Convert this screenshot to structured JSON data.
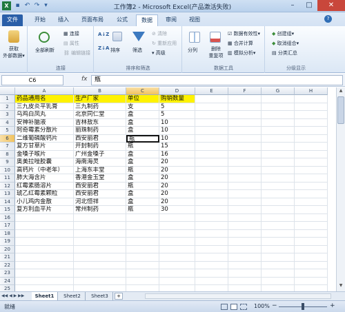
{
  "window": {
    "title": "工作簿2 - Microsoft Excel(产品激活失败)",
    "min": "–",
    "max": "□",
    "close": "✕"
  },
  "qat": {
    "save": "▪",
    "undo": "↶",
    "redo": "↷",
    "more": "▾"
  },
  "tabs": {
    "file": "文件",
    "items": [
      "开始",
      "插入",
      "页面布局",
      "公式",
      "数据",
      "审阅",
      "视图"
    ],
    "active": "数据"
  },
  "ribbon": {
    "get_external": {
      "label1": "获取",
      "label2": "外部数据▾"
    },
    "connections": {
      "refresh_all": "全部刷新",
      "connections": "连接",
      "properties": "属性",
      "edit_links": "编辑链接",
      "group_label": "连接"
    },
    "sort_filter": {
      "sort_az": "A↓Z",
      "sort_za": "Z↓A",
      "sort": "排序",
      "filter": "筛选",
      "clear": "清除",
      "reapply": "重新应用",
      "advanced": "高级",
      "group_label": "排序和筛选"
    },
    "data_tools": {
      "text_to_columns": "分列",
      "remove_dup": "删除",
      "remove_dup2": "重复项",
      "validation": "数据有效性▾",
      "consolidate": "合并计算",
      "whatif": "模拟分析▾",
      "group_label": "数据工具"
    },
    "outline": {
      "group": "创建组▾",
      "ungroup": "取消组合▾",
      "subtotal": "分类汇总",
      "group_label": "分级显示"
    }
  },
  "formula_bar": {
    "name_box": "C6",
    "fx": "fx",
    "content": "瓶"
  },
  "columns": [
    "A",
    "B",
    "C",
    "D",
    "E",
    "F",
    "G",
    "H"
  ],
  "selected_col": "C",
  "rows": [
    "1",
    "2",
    "3",
    "4",
    "5",
    "6",
    "7",
    "8",
    "9",
    "10",
    "11",
    "12",
    "13",
    "14",
    "15",
    "16",
    "17",
    "18",
    "19",
    "20",
    "21",
    "22",
    "23",
    "24",
    "25"
  ],
  "selected_row": "6",
  "table": {
    "header": [
      "药品通用名",
      "生产厂家",
      "单位",
      "购销数量"
    ],
    "body": [
      [
        "三九皮炎平乳膏",
        "三九制药",
        "支",
        "5"
      ],
      [
        "乌鸡白凤丸",
        "北京同仁堂",
        "盒",
        "5"
      ],
      [
        "安神补脑液",
        "吉林敖东",
        "盒",
        "10"
      ],
      [
        "阿奇霉素分散片",
        "丽珠制药",
        "盒",
        "10"
      ],
      [
        "二维葡磷酸钙片",
        "西安丽君",
        "瓶",
        "10"
      ],
      [
        "复方甘草片",
        "开封制药",
        "瓶",
        "15"
      ],
      [
        "金嗓子喉片",
        "广州金嗓子",
        "盒",
        "16"
      ],
      [
        "奥美拉唑胶囊",
        "海南海灵",
        "盒",
        "20"
      ],
      [
        "高钙片（中老年）",
        "上海东丰堂",
        "瓶",
        "20"
      ],
      [
        "肺大海含片",
        "香港金玉堂",
        "盒",
        "20"
      ],
      [
        "红霉素肠溶片",
        "西安丽君",
        "瓶",
        "20"
      ],
      [
        "琥乙红霉素颗粒",
        "西安丽君",
        "盒",
        "20"
      ],
      [
        "小儿鸡内金散",
        "河北恒祥",
        "盒",
        "20"
      ],
      [
        "复方利血平片",
        "常州制药",
        "瓶",
        "30"
      ]
    ]
  },
  "sheets": [
    "Sheet1",
    "Sheet2",
    "Sheet3"
  ],
  "active_sheet": "Sheet1",
  "status": {
    "ready": "就绪",
    "zoom": "100%",
    "minus": "−",
    "plus": "+"
  }
}
